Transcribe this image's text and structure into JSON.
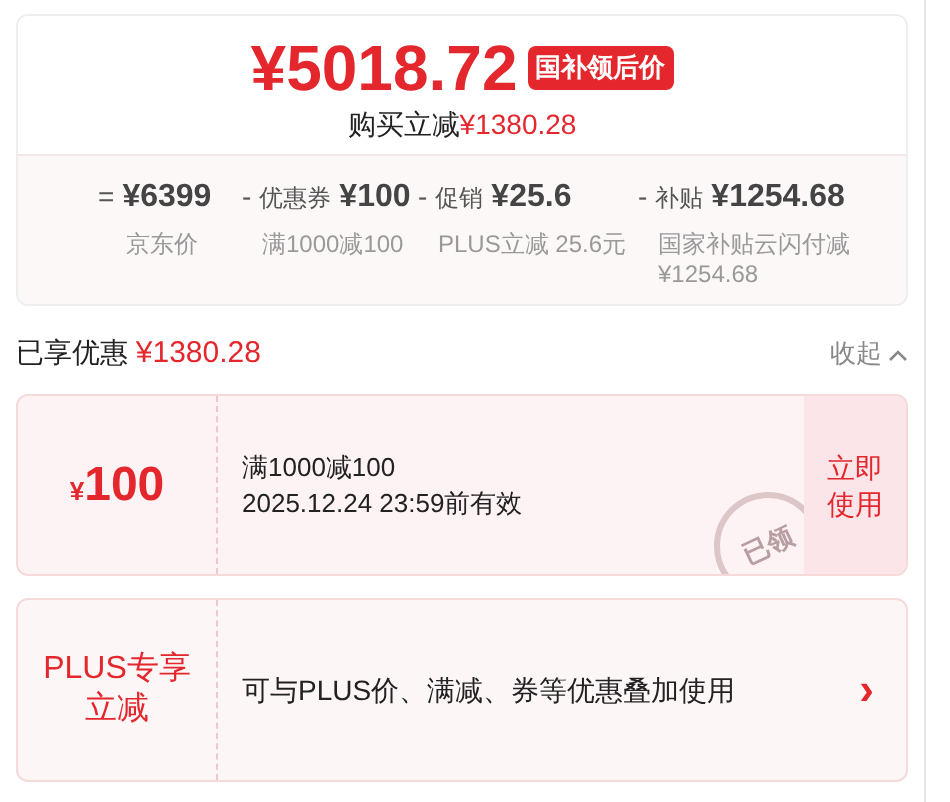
{
  "price": {
    "value": "¥5018.72",
    "badge": "国补领后价",
    "saving_label": "购买立减",
    "saving_amount": "¥1380.28"
  },
  "breakdown": [
    {
      "op": "=",
      "amount": "¥6399",
      "note": "京东价"
    },
    {
      "op": "-",
      "label": "优惠券",
      "amount": "¥100",
      "note": "满1000减100"
    },
    {
      "op": "-",
      "label": "促销",
      "amount": "¥25.6",
      "note": "PLUS立减 25.6元"
    },
    {
      "op": "-",
      "label": "补贴",
      "amount": "¥1254.68",
      "note": "国家补贴云闪付减¥1254.68"
    }
  ],
  "enjoyed": {
    "label": "已享优惠",
    "amount": "¥1380.28",
    "collapse": "收起"
  },
  "coupon": {
    "symbol": "¥",
    "amount": "100",
    "title": "满1000减100",
    "validity": "2025.12.24 23:59前有效",
    "action": "立即使用",
    "stamp": "已领"
  },
  "plus": {
    "title": "PLUS专享立减",
    "description": "可与PLUS价、满减、券等优惠叠加使用",
    "arrow": "›"
  }
}
